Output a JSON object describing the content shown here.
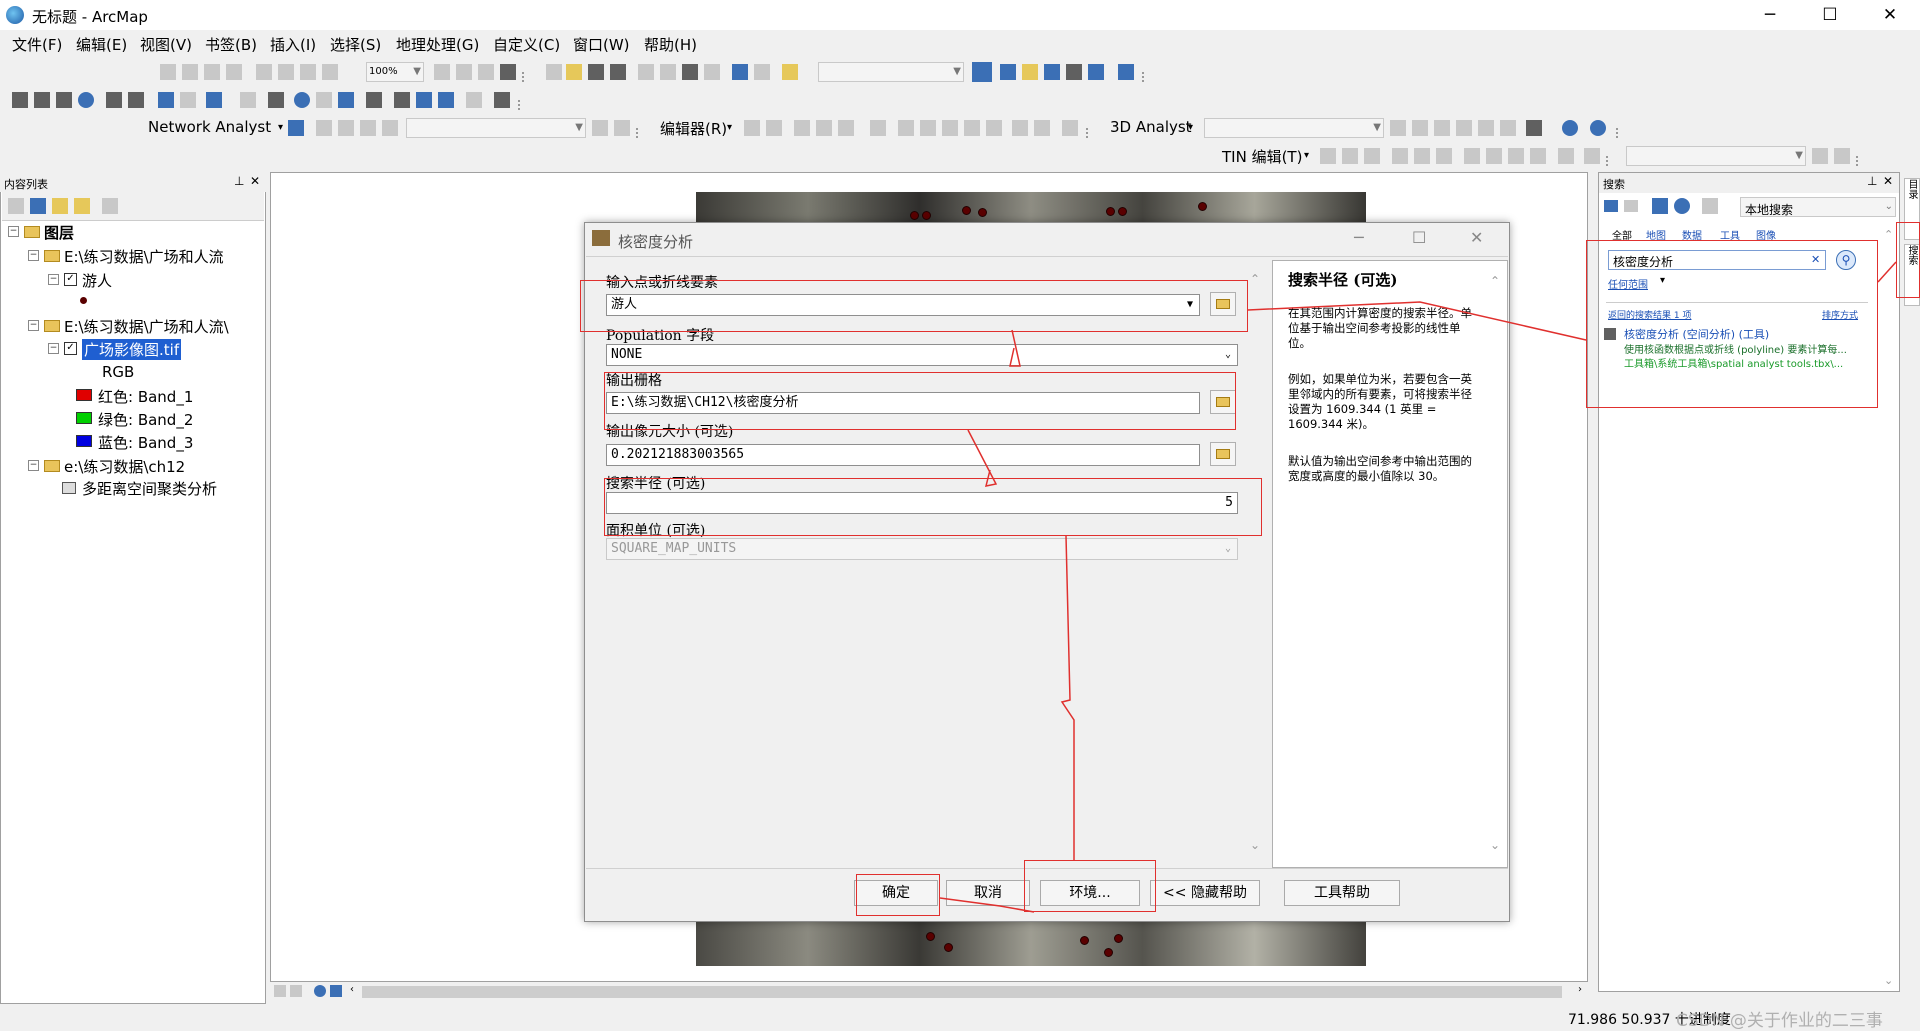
{
  "window": {
    "title": "无标题 - ArcMap",
    "minimize": "─",
    "maximize": "☐",
    "close": "✕"
  },
  "menu": [
    "文件(F)",
    "编辑(E)",
    "视图(V)",
    "书签(B)",
    "插入(I)",
    "选择(S)",
    "地理处理(G)",
    "自定义(C)",
    "窗口(W)",
    "帮助(H)"
  ],
  "toolbar": {
    "zoom_value": "100%",
    "network_analyst": "Network Analyst",
    "editor": "编辑器(R)",
    "analyst3d": "3D Analyst",
    "tin_edit": "TIN 编辑(T)"
  },
  "toc": {
    "title": "内容列表",
    "root": "图层",
    "items": [
      {
        "label": "E:\\练习数据\\广场和人流"
      },
      {
        "label": "游人"
      },
      {
        "label": "E:\\练习数据\\广场和人流\\"
      },
      {
        "label": "广场影像图.tif"
      },
      {
        "label": "RGB"
      },
      {
        "label": "红色:   Band_1",
        "color": "#e00000"
      },
      {
        "label": "绿色: Band_2",
        "color": "#00d000"
      },
      {
        "label": "蓝色:   Band_3",
        "color": "#0000e0"
      },
      {
        "label": "e:\\练习数据\\ch12"
      },
      {
        "label": "多距离空间聚类分析"
      }
    ]
  },
  "dialog": {
    "title": "核密度分析",
    "fields": {
      "input_label": "输入点或折线要素",
      "input_value": "游人",
      "population_label": "Population 字段",
      "population_value": "NONE",
      "output_label": "输出栅格",
      "output_value": "E:\\练习数据\\CH12\\核密度分析",
      "cellsize_label": "输出像元大小 (可选)",
      "cellsize_value": "0.202121883003565",
      "radius_label": "搜索半径 (可选)",
      "radius_value": "5",
      "area_label": "面积单位 (可选)",
      "area_value": "SQUARE_MAP_UNITS"
    },
    "help": {
      "title": "搜索半径 (可选)",
      "p1": "在其范围内计算密度的搜索半径。单位基于输出空间参考投影的线性单位。",
      "p2": "例如，如果单位为米，若要包含一英里邻域内的所有要素，可将搜索半径设置为 1609.344 (1 英里 = 1609.344 米)。",
      "p3": "默认值为输出空间参考中输出范围的宽度或高度的最小值除以 30。"
    },
    "buttons": {
      "ok": "确定",
      "cancel": "取消",
      "env": "环境...",
      "hide_help": "<< 隐藏帮助",
      "tool_help": "工具帮助"
    }
  },
  "search": {
    "title": "搜索",
    "scope_select": "本地搜索",
    "tabs": [
      "全部",
      "地图",
      "数据",
      "工具",
      "图像"
    ],
    "query": "核密度分析",
    "any_extent": "任何范围",
    "results_count": "返回的搜索结果 1 项",
    "sort": "排序方式",
    "result_title": "核密度分析 (空间分析) (工具)",
    "result_desc": "使用核函数根据点或折线 (polyline) 要素计算每...",
    "result_path": "工具箱\\系统工具箱\\spatial analyst tools.tbx\\..."
  },
  "right_strip": {
    "tab1": "目录",
    "tab2": "搜索"
  },
  "status": {
    "coords": "71.986  50.937 十进制度",
    "watermark": "CSDN @关于作业的二三事"
  }
}
